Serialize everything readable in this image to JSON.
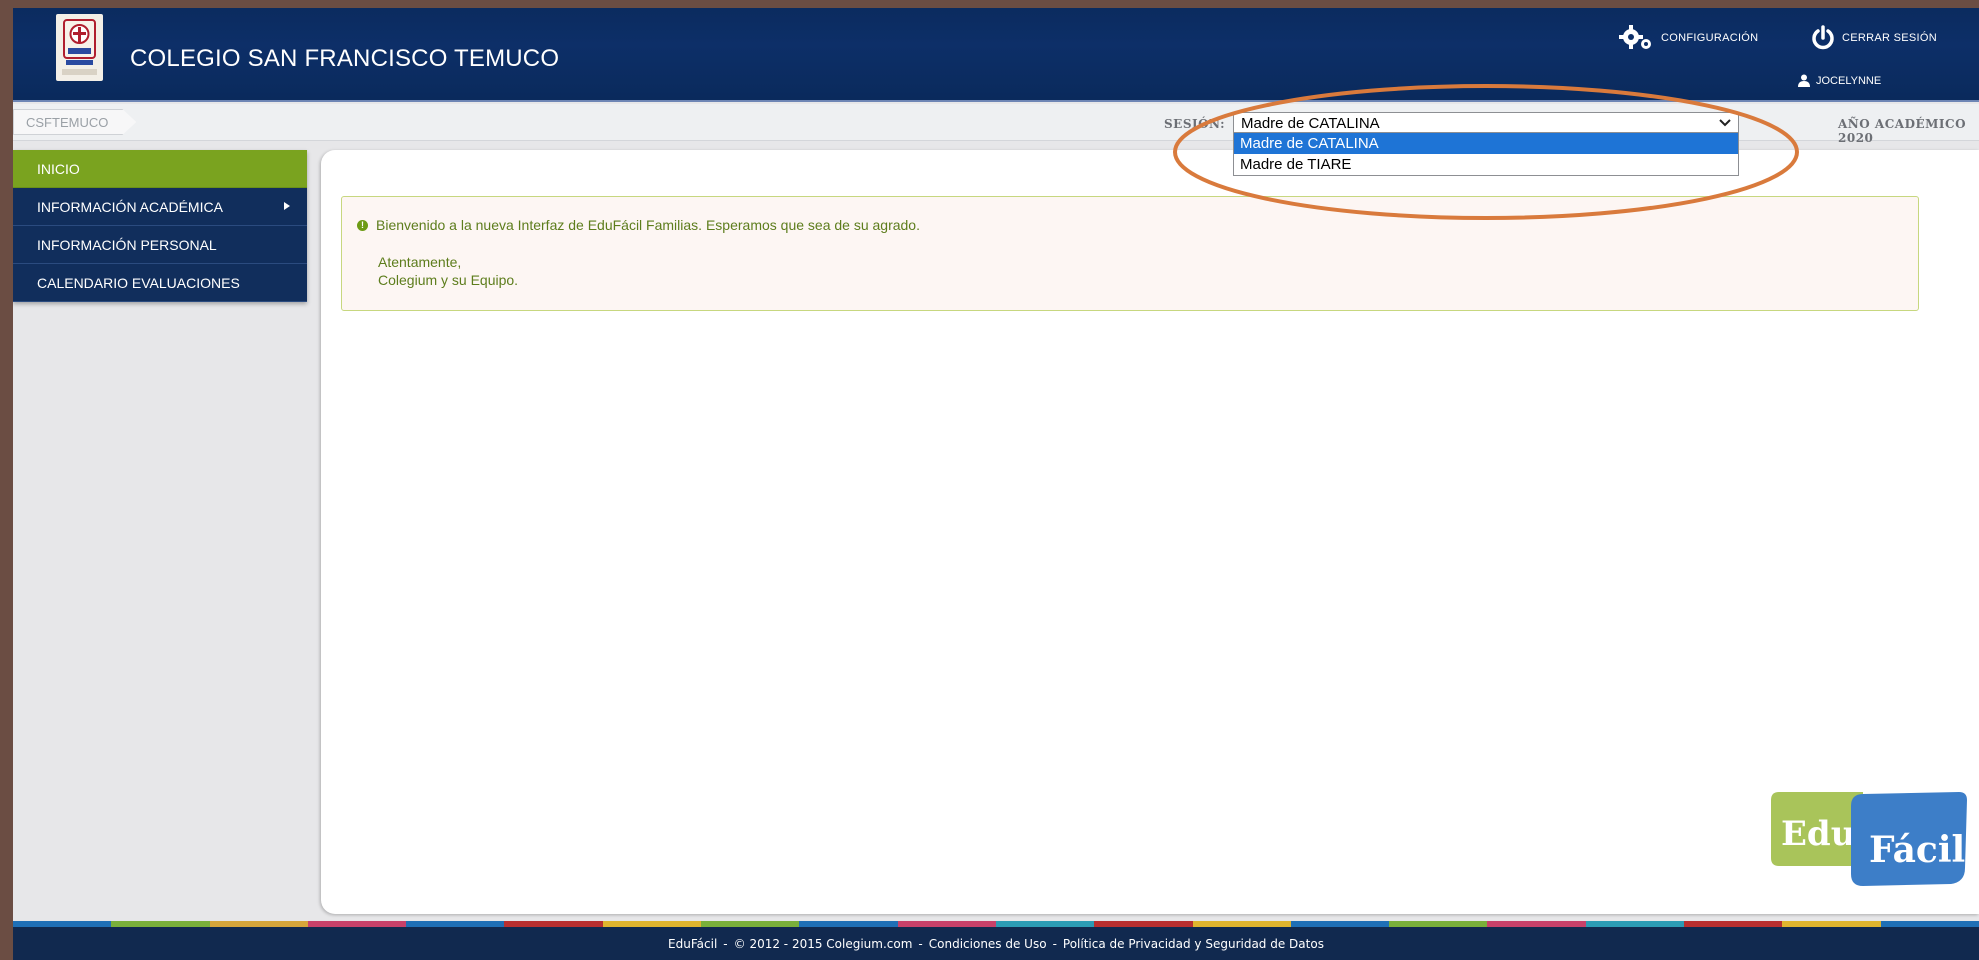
{
  "header": {
    "school_name": "COLEGIO SAN FRANCISCO TEMUCO",
    "config_label": "CONFIGURACIÓN",
    "logout_label": "CERRAR SESIÓN",
    "user_name": "JOCELYNNE"
  },
  "subbar": {
    "breadcrumb": "CSFTEMUCO",
    "session_label": "SESIÓN:",
    "session_selected": "Madre de CATALINA",
    "session_options": [
      "Madre de CATALINA",
      "Madre de TIARE"
    ],
    "academic_year": "AÑO ACADÉMICO  2020"
  },
  "sidebar": {
    "items": [
      {
        "label": "INICIO"
      },
      {
        "label": "INFORMACIÓN ACADÉMICA"
      },
      {
        "label": "INFORMACIÓN PERSONAL"
      },
      {
        "label": "CALENDARIO EVALUACIONES"
      }
    ]
  },
  "alert": {
    "message": "Bienvenido a la nueva Interfaz de EduFácil Familias. Esperamos que sea de su agrado.",
    "closing": "Atentamente,",
    "signature": "Colegium y su Equipo."
  },
  "logo": {
    "part1": "Edu",
    "part2": "Fácil"
  },
  "footer": {
    "brand": "EduFácil",
    "copyright": "© 2012 - 2015 Colegium.com",
    "terms": "Condiciones de Uso",
    "privacy": "Política de Privacidad y Seguridad de Datos"
  },
  "colors": {
    "header_bg": "#0d2f68",
    "nav_bg": "#112e5c",
    "nav_active": "#7aa31f",
    "annotation": "#d97a3c"
  },
  "icons": [
    "gears-icon",
    "power-icon",
    "user-icon",
    "info-icon",
    "chevron-down-icon",
    "caret-right-icon"
  ]
}
